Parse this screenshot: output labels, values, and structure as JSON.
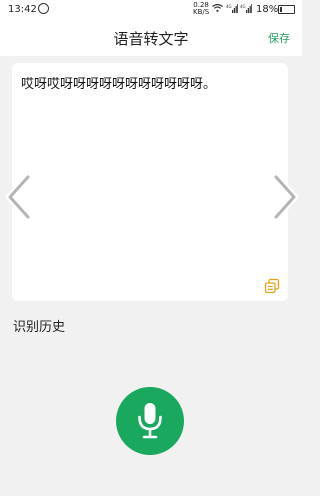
{
  "status_bar": {
    "time": "13:42",
    "net_speed_value": "0.28",
    "net_speed_unit": "KB/S",
    "network_label_1": "4G",
    "network_label_2": "4G",
    "battery": "18%",
    "battery_level": 0.18
  },
  "header": {
    "title": "语音转文字",
    "save_label": "保存"
  },
  "transcript": {
    "text": "哎呀哎呀呀呀呀呀呀呀呀呀呀呀。"
  },
  "history": {
    "label": "识别历史"
  },
  "icons": {
    "alarm": "alarm-icon",
    "wifi": "wifi-icon",
    "signal": "signal-icon",
    "battery": "battery-icon",
    "prev": "chevron-left-icon",
    "next": "chevron-right-icon",
    "copy": "copy-icon",
    "mic": "microphone-icon"
  },
  "colors": {
    "accent": "#27a061",
    "mic_button": "#1aa75e",
    "page_bg": "#f1f1f1"
  }
}
